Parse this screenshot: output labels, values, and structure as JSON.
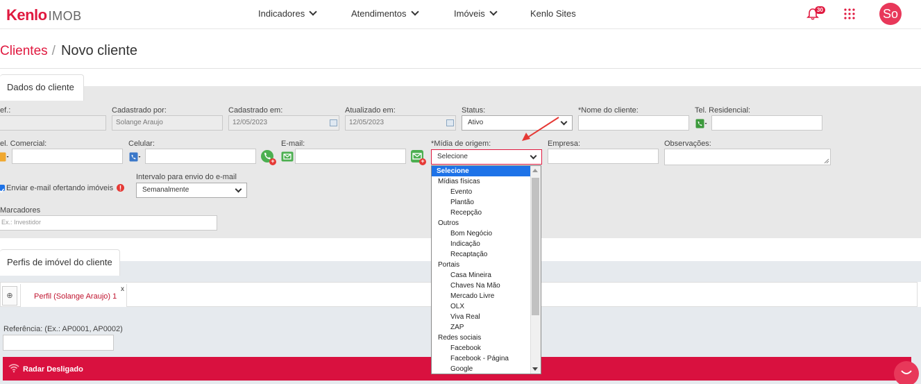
{
  "nav": {
    "logo_kenlo": "Kenlo",
    "logo_imob": "IMOB",
    "items": [
      "Indicadores",
      "Atendimentos",
      "Imóveis",
      "Kenlo Sites"
    ],
    "notification_count": "30",
    "avatar_initials": "So"
  },
  "breadcrumb": {
    "parent": "Clientes",
    "separator": "/",
    "current": "Novo cliente"
  },
  "dados": {
    "tab_label": "Dados do cliente",
    "ref_label": "ef.:",
    "cadastrado_por_label": "Cadastrado por:",
    "cadastrado_por_value": "Solange Araujo",
    "cadastrado_em_label": "Cadastrado em:",
    "cadastrado_em_value": "12/05/2023",
    "atualizado_em_label": "Atualizado em:",
    "atualizado_em_value": "12/05/2023",
    "status_label": "Status:",
    "status_value": "Ativo",
    "nome_label": "*Nome do cliente:",
    "tel_res_label": "Tel. Residencial:",
    "tel_com_label": "el. Comercial:",
    "celular_label": "Celular:",
    "email_label": "E-mail:",
    "midia_label": "*Mídia de origem:",
    "midia_value": "Selecione",
    "empresa_label": "Empresa:",
    "observacoes_label": "Observações:",
    "enviar_email_label": "Enviar e-mail ofertando imóveis",
    "intervalo_label": "Intervalo para envio do e-mail",
    "intervalo_value": "Semanalmente",
    "marcadores_label": "Marcadores",
    "marcadores_placeholder": "Ex.: Investidor"
  },
  "dropdown": {
    "selected": "Selecione",
    "items": [
      {
        "type": "grp",
        "label": "Mídias físicas"
      },
      {
        "type": "opt",
        "label": "Evento"
      },
      {
        "type": "opt",
        "label": "Plantão"
      },
      {
        "type": "opt",
        "label": "Recepção"
      },
      {
        "type": "grp",
        "label": "Outros"
      },
      {
        "type": "opt",
        "label": "Bom Negócio"
      },
      {
        "type": "opt",
        "label": "Indicação"
      },
      {
        "type": "opt",
        "label": "Recaptação"
      },
      {
        "type": "grp",
        "label": "Portais"
      },
      {
        "type": "opt",
        "label": "Casa Mineira"
      },
      {
        "type": "opt",
        "label": "Chaves Na Mão"
      },
      {
        "type": "opt",
        "label": "Mercado Livre"
      },
      {
        "type": "opt",
        "label": "OLX"
      },
      {
        "type": "opt",
        "label": "Viva Real"
      },
      {
        "type": "opt",
        "label": "ZAP"
      },
      {
        "type": "grp",
        "label": "Redes sociais"
      },
      {
        "type": "opt",
        "label": "Facebook"
      },
      {
        "type": "opt",
        "label": "Facebook - Página"
      },
      {
        "type": "opt",
        "label": "Google"
      }
    ]
  },
  "perfis": {
    "tab_label": "Perfis de imóvel do cliente",
    "add_symbol": "⊕",
    "profile_tab": "Perfil (Solange Araujo) 1",
    "close_symbol": "x",
    "referencia_label": "Referência: (Ex.: AP0001, AP0002)",
    "radar_label": "Radar Desligado"
  },
  "colors": {
    "brand": "#e0193f",
    "radar": "#d9113f",
    "highlight": "#1e73e8"
  }
}
